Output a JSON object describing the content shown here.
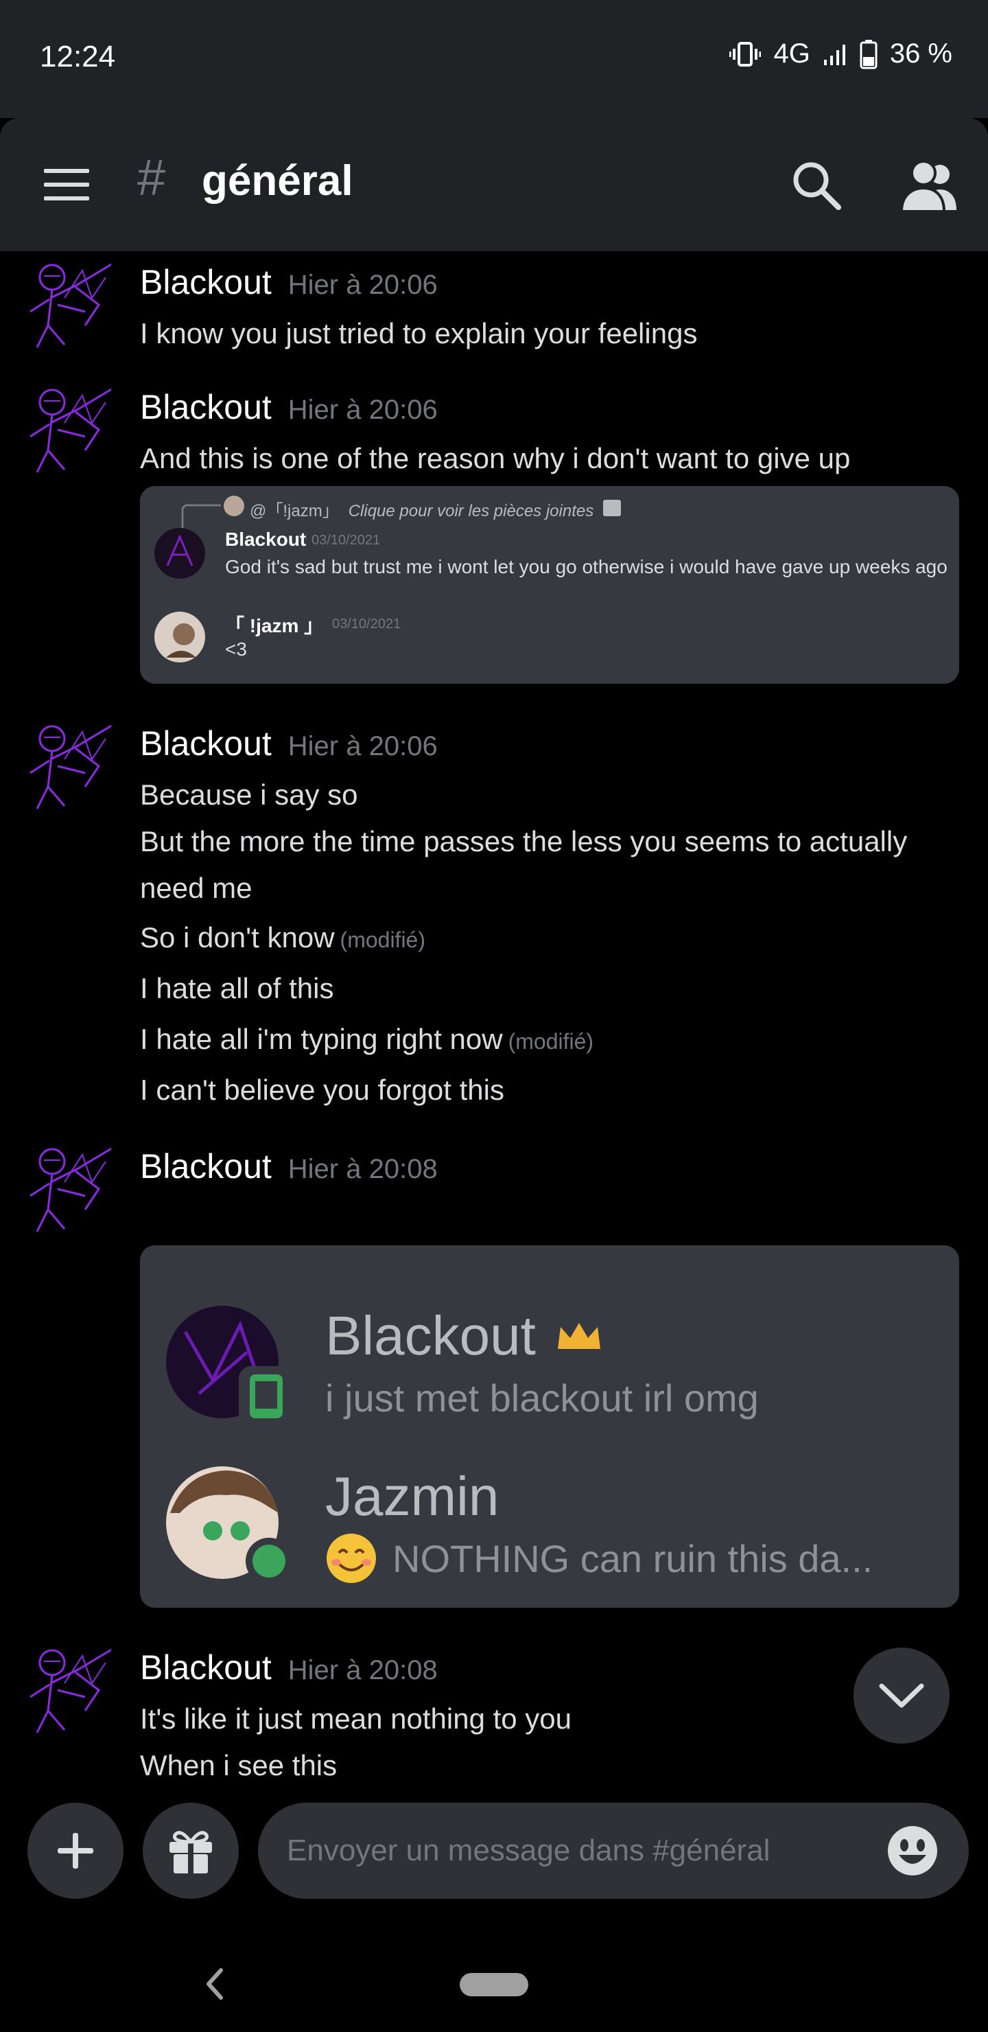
{
  "status_bar": {
    "time": "12:24",
    "network": "4G",
    "battery": "36 %"
  },
  "app_bar": {
    "channel_name": "général"
  },
  "messages": [
    {
      "author": "Blackout",
      "timestamp": "Hier à 20:06",
      "lines": [
        "I know you just tried to explain your feelings"
      ]
    },
    {
      "author": "Blackout",
      "timestamp": "Hier à 20:06",
      "lines": [
        "And this is one of the reason why i don't want to give up"
      ]
    },
    {
      "author": "Blackout",
      "timestamp": "Hier à 20:06",
      "lines": [
        "Because i say so",
        "But the more the time passes the less you seems to actually",
        "need me",
        "So i don't know",
        "I hate all of this",
        "I hate all i'm typing right now",
        "I can't believe you forgot this"
      ],
      "edited_label": "(modifié)"
    },
    {
      "author": "Blackout",
      "timestamp": "Hier à 20:08",
      "lines": []
    },
    {
      "author": "Blackout",
      "timestamp": "Hier à 20:08",
      "lines": [
        "It's like it just mean nothing to you",
        "When i see this"
      ]
    }
  ],
  "embed1": {
    "reply_to": "@「!jazm」",
    "reply_hint": "Clique pour voir les pièces jointes",
    "first": {
      "author": "Blackout",
      "date": "03/10/2021",
      "text": "God it's sad but trust me i wont let you go otherwise i would have gave up weeks ago"
    },
    "second": {
      "author": "「 !jazm 」",
      "date": "03/10/2021",
      "text": "<3"
    }
  },
  "embed2": {
    "users": [
      {
        "name": "Blackout",
        "status": "i just met blackout irl omg",
        "status_color": "#3ba55c"
      },
      {
        "name": "Jazmin",
        "status": "NOTHING can ruin this da...",
        "status_color": "#3ba55c"
      }
    ]
  },
  "composer": {
    "placeholder": "Envoyer un message dans #général"
  },
  "colors": {
    "background": "#000000",
    "bar": "#202225",
    "card": "#36393f",
    "muted": "#72767d",
    "online": "#3ba55c",
    "avatar_purple": "#8a2be2"
  }
}
